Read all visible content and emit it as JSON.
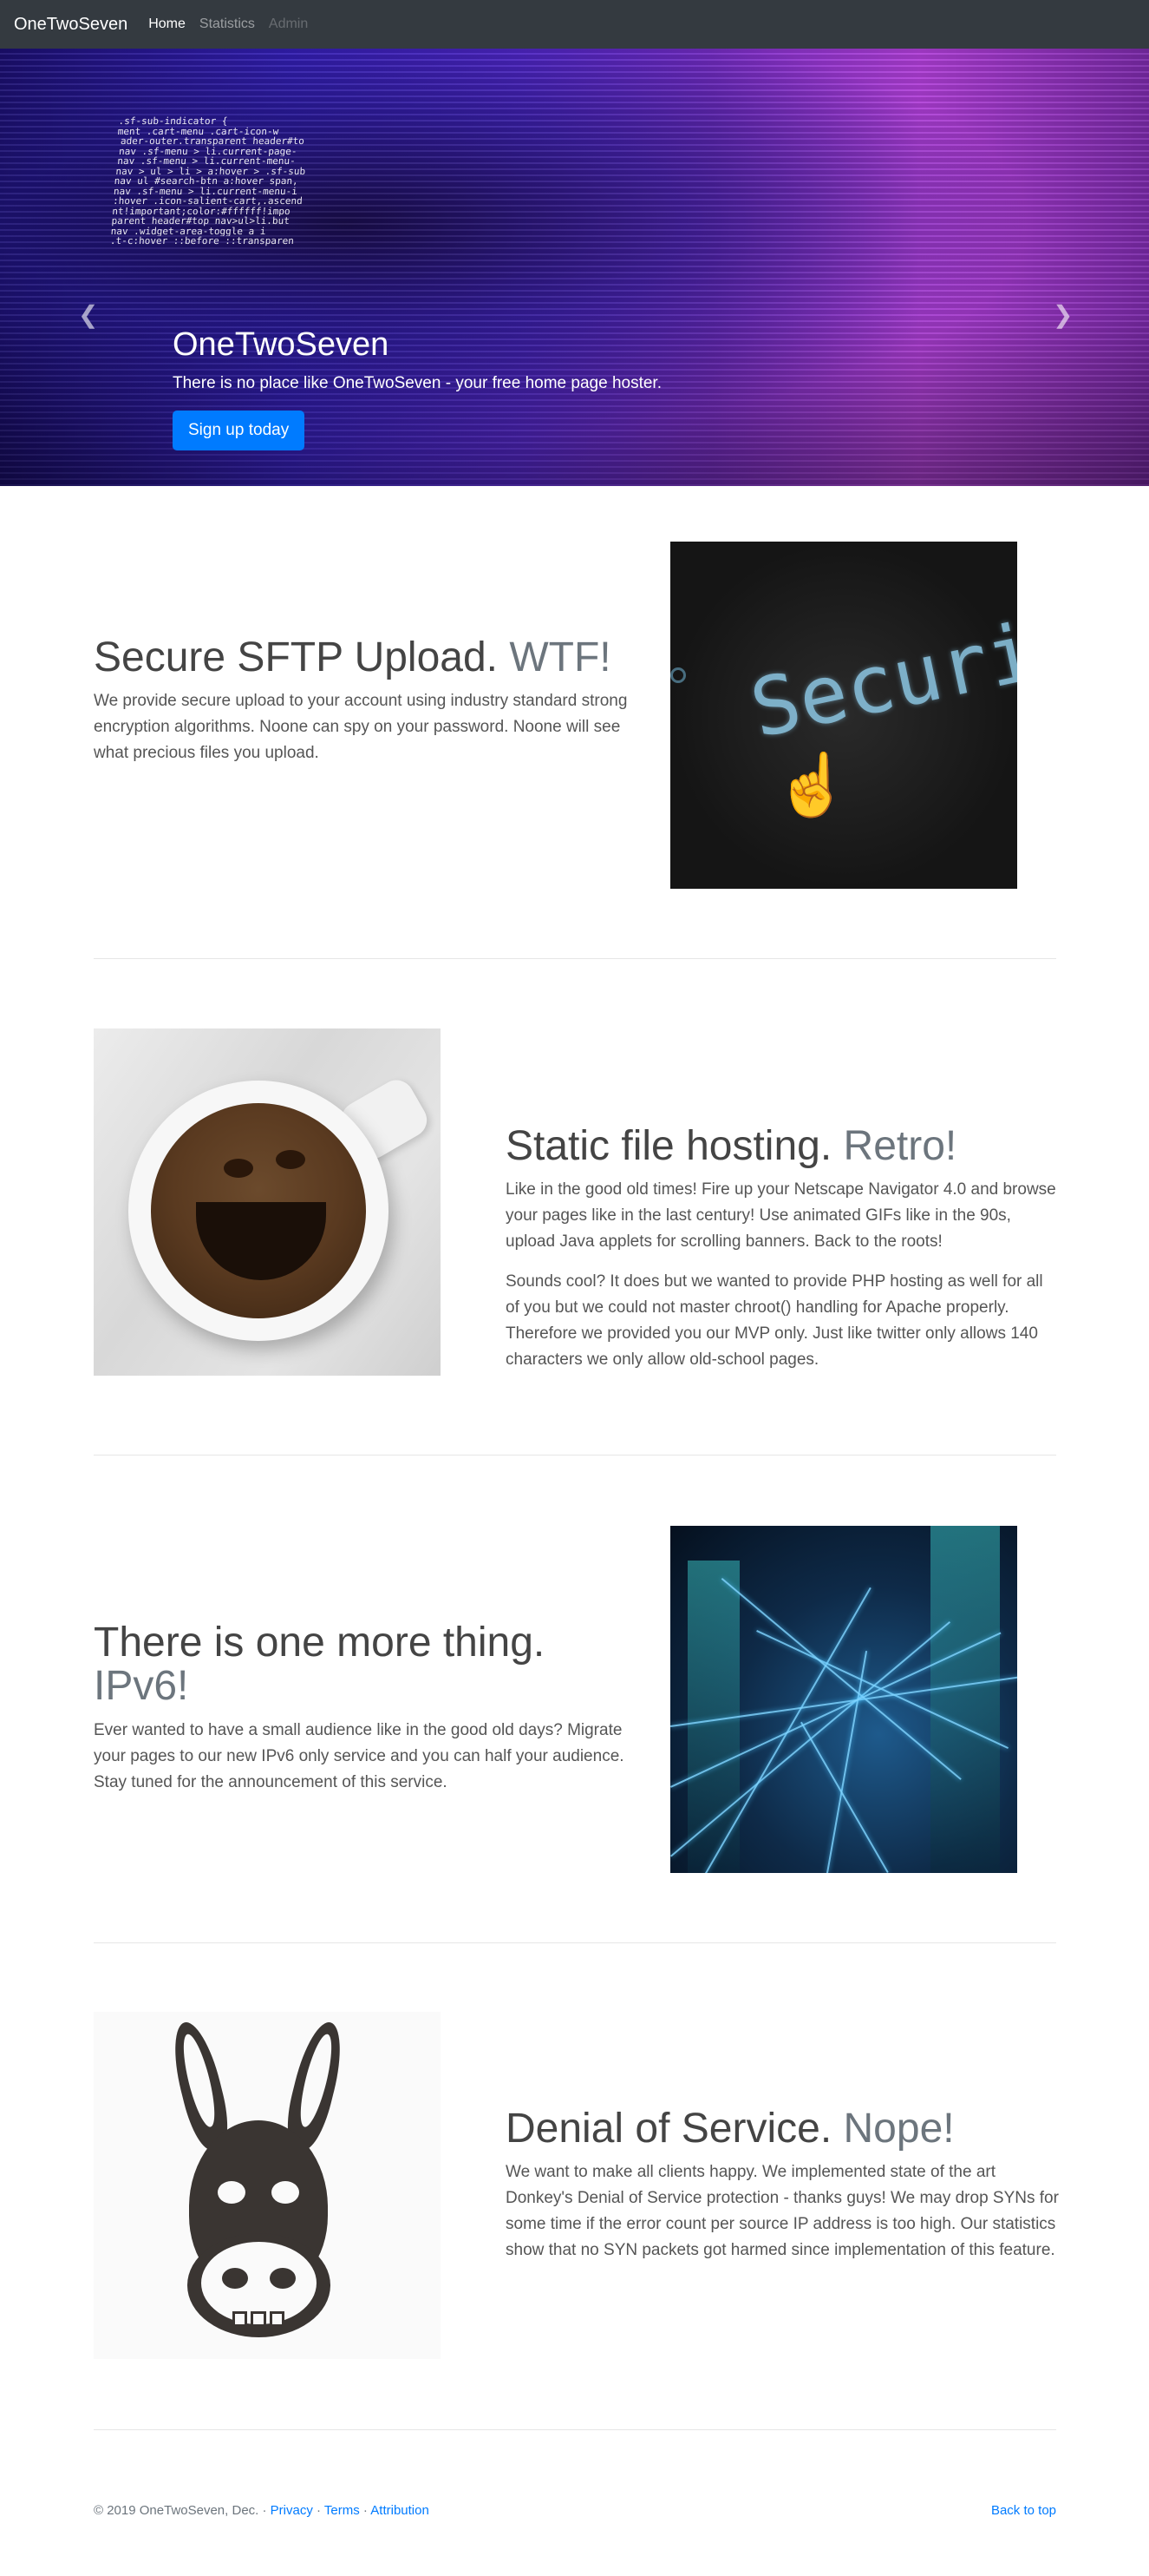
{
  "navbar": {
    "brand": "OneTwoSeven",
    "links": [
      {
        "label": "Home",
        "state": "active"
      },
      {
        "label": "Statistics",
        "state": "normal"
      },
      {
        "label": "Admin",
        "state": "disabled"
      }
    ]
  },
  "hero": {
    "title": "OneTwoSeven",
    "subtitle": "There is no place like OneTwoSeven - your free home page hoster.",
    "button_label": "Sign up today",
    "prev_icon": "chevron-left-icon",
    "next_icon": "chevron-right-icon",
    "slides_count": 3,
    "active_slide": 1,
    "code_lines": [
      "                 .sf-sub-indicator {",
      "ment .cart-menu .cart-icon-w",
      "ader-outer.transparent header#to",
      " nav .sf-menu > li.current-page-",
      " nav .sf-menu > li.current-menu-",
      " nav > ul > li > a:hover > .sf-sub",
      " nav ul #search-btn a:hover span,",
      " nav .sf-menu > li.current-menu-i",
      ":hover .icon-salient-cart,.ascend",
      "nt!important;color:#ffffff!impo",
      "parent header#top nav>ul>li.but",
      "  nav .widget-area-toggle a i",
      "  .t-c:hover ::before ::transparen"
    ]
  },
  "features": [
    {
      "heading": "Secure SFTP Upload.",
      "heading_muted": "WTF!",
      "paragraphs": [
        "We provide secure upload to your account using industry standard strong encryption algorithms. Noone can spy on your password. Noone will see what precious files you upload."
      ],
      "image_word": "Security"
    },
    {
      "heading": "Static file hosting.",
      "heading_muted": "Retro!",
      "paragraphs": [
        "Like in the good old times! Fire up your Netscape Navigator 4.0 and browse your pages like in the last century! Use animated GIFs like in the 90s, upload Java applets for scrolling banners. Back to the roots!",
        "Sounds cool? It does but we wanted to provide PHP hosting as well for all of you but we could not master chroot() handling for Apache properly. Therefore we provided you our MVP only. Just like twitter only allows 140 characters we only allow old-school pages."
      ]
    },
    {
      "heading": "There is one more thing.",
      "heading_muted": "IPv6!",
      "paragraphs": [
        "Ever wanted to have a small audience like in the good old days? Migrate your pages to our new IPv6 only service and you can half your audience. Stay tuned for the announcement of this service."
      ]
    },
    {
      "heading": "Denial of Service.",
      "heading_muted": "Nope!",
      "paragraphs": [
        "We want to make all clients happy. We implemented state of the art Donkey's Denial of Service protection - thanks guys! We may drop SYNs for some time if the error count per source IP address is too high. Our statistics show that no SYN packets got harmed since implementation of this feature."
      ]
    }
  ],
  "footer": {
    "copyright": "© 2019 OneTwoSeven, Dec. · ",
    "privacy": "Privacy",
    "sep1": " · ",
    "terms": "Terms",
    "sep2": " · ",
    "attribution": "Attribution",
    "back_to_top": "Back to top"
  },
  "colors": {
    "navbar_bg": "#343a40",
    "primary": "#007bff",
    "muted": "#6c757d"
  }
}
